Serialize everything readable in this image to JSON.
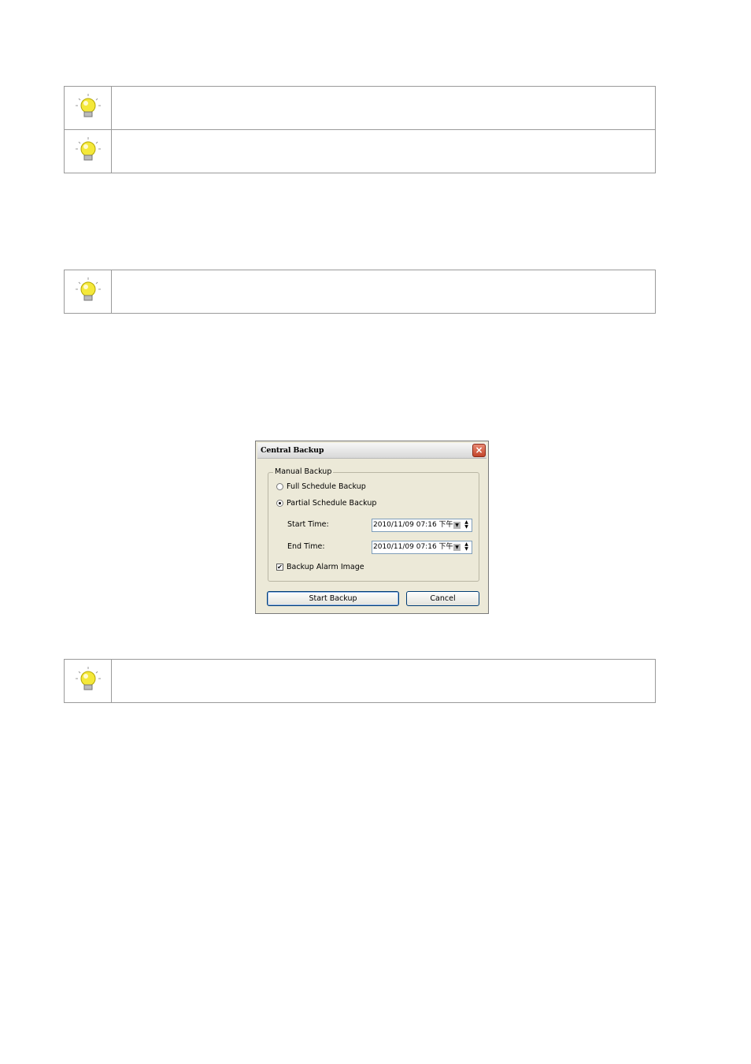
{
  "tips": [
    {
      "icon": "lightbulb-icon",
      "text": ""
    },
    {
      "icon": "lightbulb-icon",
      "text": ""
    },
    {
      "icon": "lightbulb-icon",
      "text": ""
    },
    {
      "icon": "lightbulb-icon",
      "text": ""
    }
  ],
  "dialog": {
    "title": "Central Backup",
    "close_label": "×",
    "group_title": "Manual Backup",
    "options": {
      "full": {
        "label": "Full Schedule Backup",
        "selected": false
      },
      "partial": {
        "label": "Partial Schedule Backup",
        "selected": true
      }
    },
    "start_time_label": "Start Time:",
    "start_time_value": "2010/11/09 07:16 下午",
    "end_time_label": "End Time:",
    "end_time_value": "2010/11/09 07:16 下午",
    "alarm_label": "Backup Alarm Image",
    "alarm_checked": true,
    "start_button": "Start Backup",
    "cancel_button": "Cancel"
  },
  "colors": {
    "bulb": "#f4e83a",
    "close_button": "#c2452b"
  }
}
